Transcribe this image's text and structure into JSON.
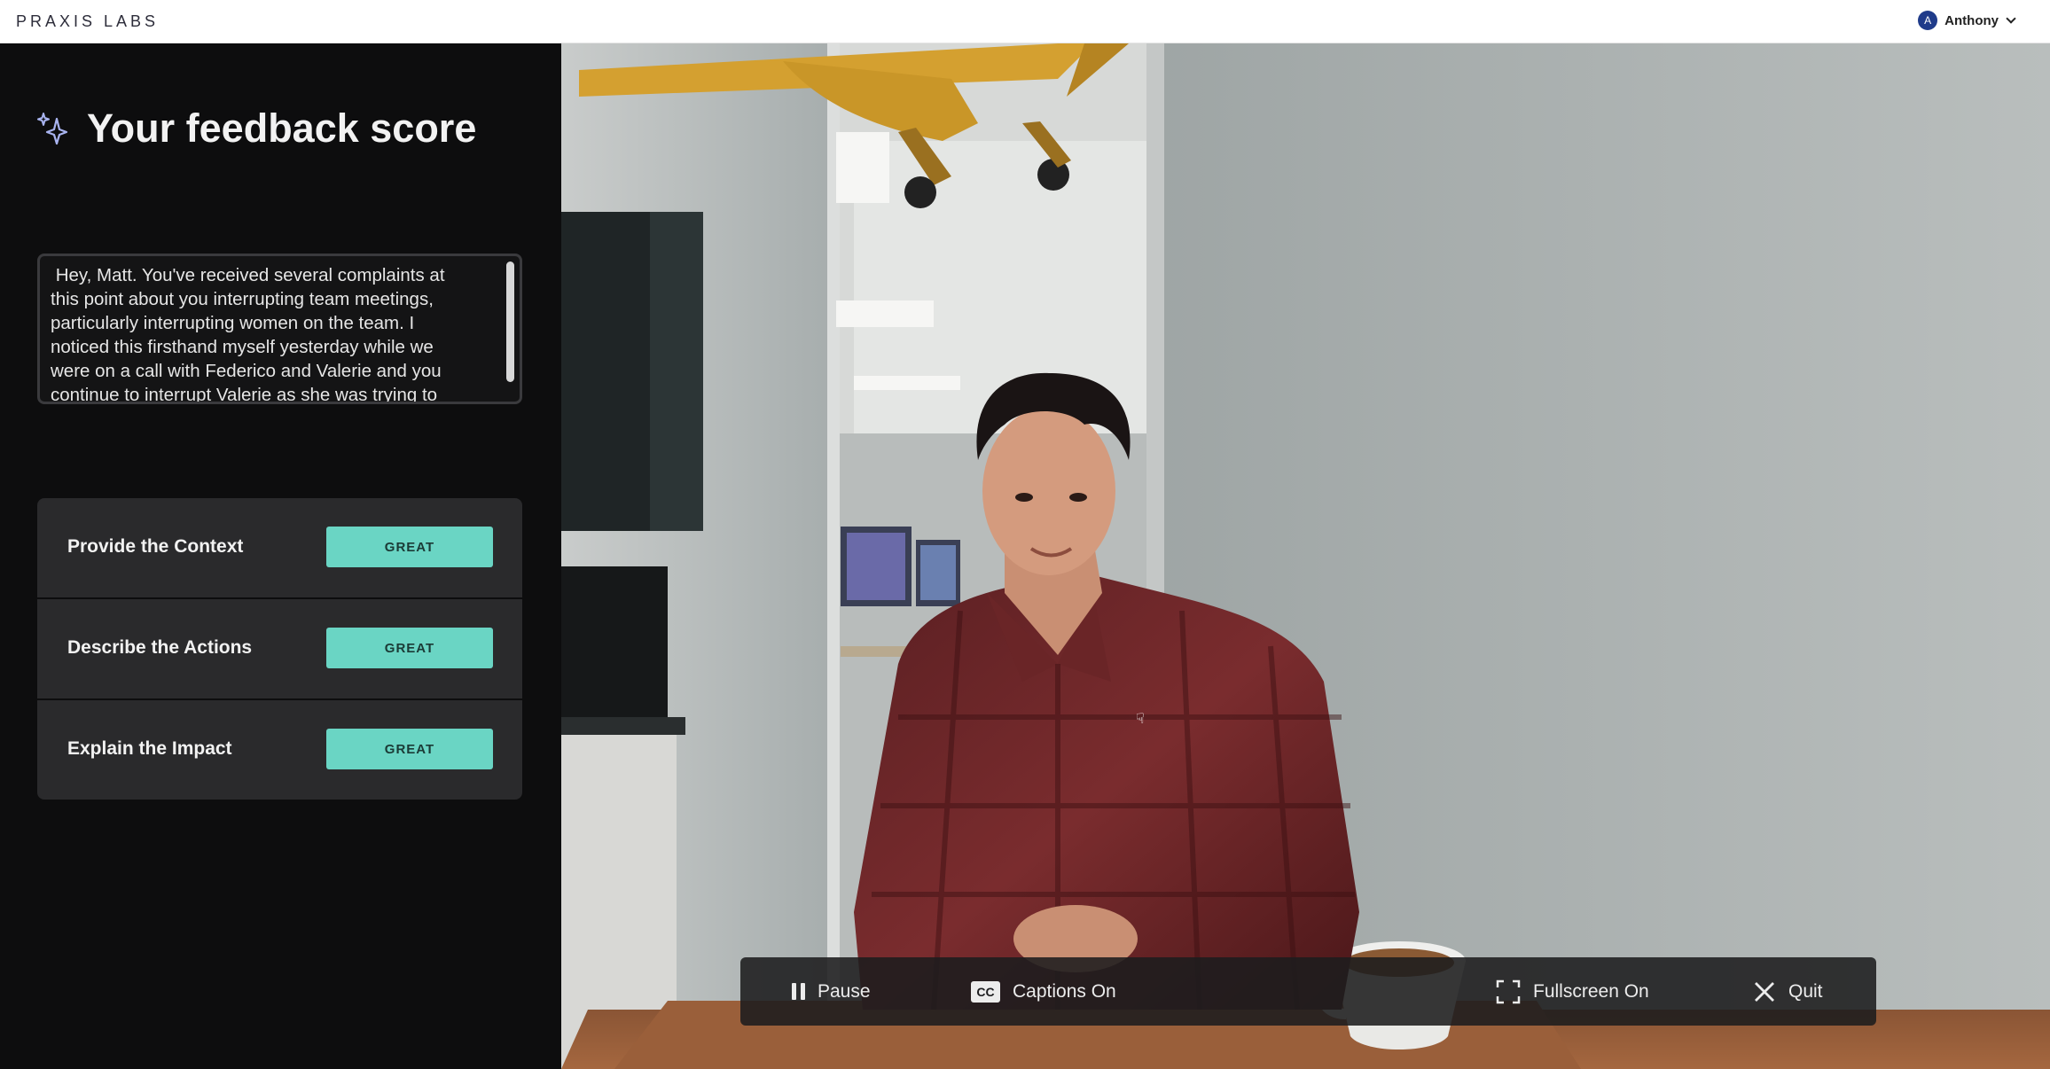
{
  "header": {
    "logo": "PRAXIS LABS",
    "user": {
      "initial": "A",
      "name": "Anthony"
    }
  },
  "feedback": {
    "title": "Your feedback score",
    "transcript": " Hey, Matt. You've received several complaints at\nthis point about you interrupting team meetings,\nparticularly interrupting women on the team. I\nnoticed this firsthand myself yesterday while we\nwere on a call with Federico and Valerie and you\ncontinue to interrupt Valerie as she was trying to\nanswer questions directed towards her. When you\ninterrupt team meetings like this, it derails a team",
    "scores": [
      {
        "label": "Provide the Context",
        "rating": "GREAT"
      },
      {
        "label": "Describe the Actions",
        "rating": "GREAT"
      },
      {
        "label": "Explain the Impact",
        "rating": "GREAT"
      }
    ],
    "accent_color": "#6ad5c4"
  },
  "controls": {
    "pause": "Pause",
    "captions": "Captions On",
    "captions_icon_text": "CC",
    "fullscreen": "Fullscreen On",
    "quit": "Quit"
  }
}
